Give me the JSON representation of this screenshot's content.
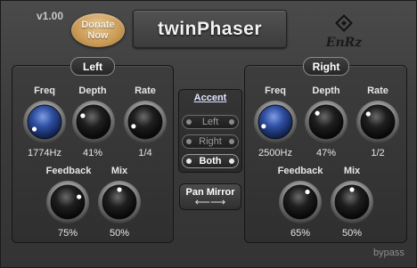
{
  "header": {
    "version": "v1.00",
    "donate_line1": "Donate",
    "donate_line2": "Now",
    "title": "twinPhaser",
    "logo_text": "EnRz"
  },
  "left": {
    "label": "Left",
    "freq": {
      "label": "Freq",
      "value": "1774Hz",
      "style": "blue"
    },
    "depth": {
      "label": "Depth",
      "value": "41%"
    },
    "rate": {
      "label": "Rate",
      "value": "1/4"
    },
    "feedback": {
      "label": "Feedback",
      "value": "75%"
    },
    "mix": {
      "label": "Mix",
      "value": "50%"
    }
  },
  "right": {
    "label": "Right",
    "freq": {
      "label": "Freq",
      "value": "2500Hz",
      "style": "blue"
    },
    "depth": {
      "label": "Depth",
      "value": "47%"
    },
    "rate": {
      "label": "Rate",
      "value": "1/2"
    },
    "feedback": {
      "label": "Feedback",
      "value": "65%"
    },
    "mix": {
      "label": "Mix",
      "value": "50%"
    }
  },
  "accent": {
    "title": "Accent",
    "options": [
      "Left",
      "Right",
      "Both"
    ],
    "selected": "Both"
  },
  "pan_mirror": {
    "label": "Pan Mirror",
    "arrows": "⟵⟶"
  },
  "footer": {
    "bypass": "bypass"
  },
  "knob_angles": {
    "left_freq": -125,
    "left_depth": -60,
    "left_rate": -110,
    "left_feedback": 65,
    "left_mix": 0,
    "right_freq": -110,
    "right_depth": -45,
    "right_rate": -50,
    "right_feedback": 35,
    "right_mix": 0
  },
  "colors": {
    "blue_knob": "#2f4fa0",
    "black_knob": "#1a1a1a",
    "donate": "#c99a55"
  }
}
